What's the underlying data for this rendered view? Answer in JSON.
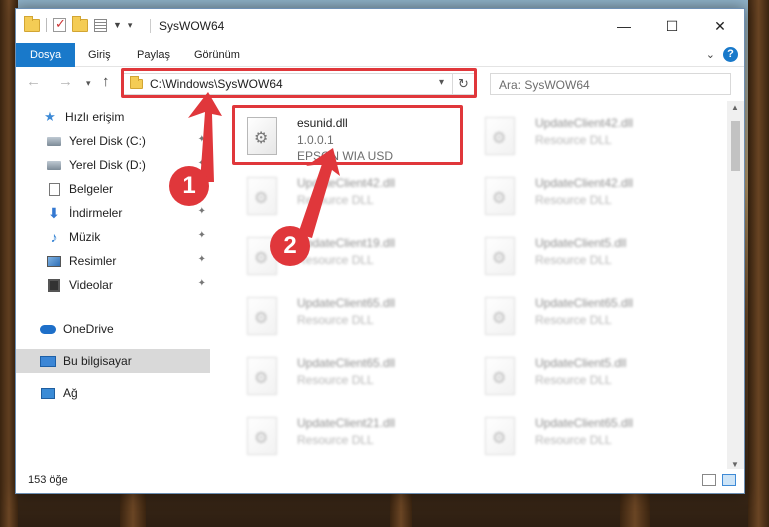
{
  "window": {
    "title": "SysWOW64",
    "controls": {
      "minimize": "—",
      "maximize": "☐",
      "close": "✕"
    }
  },
  "ribbon": {
    "tabs": [
      "Dosya",
      "Giriş",
      "Paylaş",
      "Görünüm"
    ],
    "active_tab": "Dosya",
    "accent_color": "#1979ca"
  },
  "address_bar": {
    "path": "C:\\Windows\\SysWOW64",
    "search_placeholder": "Ara: SysWOW64"
  },
  "nav_pane": {
    "items": [
      {
        "label": "Hızlı erişim",
        "icon": "star-icon",
        "pinned": false
      },
      {
        "label": "Yerel Disk (C:)",
        "icon": "drive-icon",
        "pinned": true
      },
      {
        "label": "Yerel Disk (D:)",
        "icon": "drive-icon",
        "pinned": true
      },
      {
        "label": "Belgeler",
        "icon": "document-icon",
        "pinned": true
      },
      {
        "label": "İndirmeler",
        "icon": "download-icon",
        "pinned": true
      },
      {
        "label": "Müzik",
        "icon": "music-icon",
        "pinned": true
      },
      {
        "label": "Resimler",
        "icon": "pictures-icon",
        "pinned": true
      },
      {
        "label": "Videolar",
        "icon": "video-icon",
        "pinned": true
      },
      {
        "label": "OneDrive",
        "icon": "onedrive-icon",
        "pinned": false
      },
      {
        "label": "Bu bilgisayar",
        "icon": "computer-icon",
        "pinned": false,
        "selected": true
      },
      {
        "label": "Ağ",
        "icon": "network-icon",
        "pinned": false
      }
    ]
  },
  "files": {
    "highlighted": {
      "name": "esunid.dll",
      "version": "1.0.0.1",
      "description": "EPSON WIA USD"
    },
    "left_column": [
      {
        "name": "UpdateClient42.dll",
        "type": "Resource DLL"
      },
      {
        "name": "UpdateClient19.dll",
        "type": "Resource DLL"
      },
      {
        "name": "UpdateClient65.dll",
        "type": "Resource DLL"
      },
      {
        "name": "UpdateClient65.dll",
        "type": "Resource DLL"
      },
      {
        "name": "UpdateClient21.dll",
        "type": "Resource DLL"
      }
    ],
    "right_column": [
      {
        "name": "UpdateClient42.dll",
        "type": "Resource DLL"
      },
      {
        "name": "UpdateClient42.dll",
        "type": "Resource DLL"
      },
      {
        "name": "UpdateClient5.dll",
        "type": "Resource DLL"
      },
      {
        "name": "UpdateClient65.dll",
        "type": "Resource DLL"
      },
      {
        "name": "UpdateClient5.dll",
        "type": "Resource DLL"
      },
      {
        "name": "UpdateClient65.dll",
        "type": "Resource DLL"
      }
    ]
  },
  "status": {
    "item_count": "153 öğe"
  },
  "annotations": {
    "badge1": "1",
    "badge2": "2",
    "color": "#e0373b"
  }
}
